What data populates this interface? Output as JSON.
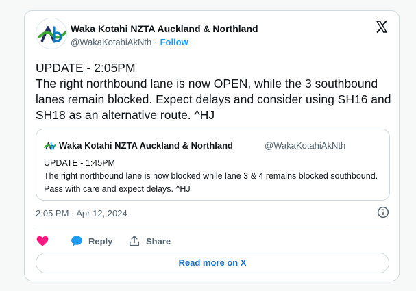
{
  "tweet": {
    "author_name": "Waka Kotahi NZTA Auckland & Northland",
    "author_handle": "@WakaKotahiAkNth",
    "separator": "·",
    "follow_label": "Follow",
    "text_line1": "UPDATE - 2:05PM",
    "text_line2": "The right northbound lane is now OPEN, while the 3 southbound lanes remain blocked. Expect delays and consider using SH16 and SH18 as an alternative route. ^HJ",
    "timestamp": "2:05 PM · Apr 12, 2024"
  },
  "quoted_tweet": {
    "author_name": "Waka Kotahi NZTA Auckland & Northland",
    "author_handle": "@WakaKotahiAkNth",
    "text_line1": "UPDATE - 1:45PM",
    "text_line2": "The right northbound lane is now blocked while lane 3 & 4 remains blocked southbound. Pass with care and expect delays. ^HJ"
  },
  "actions": {
    "like_icon": "heart-icon",
    "reply_label": "Reply",
    "reply_icon": "speech-bubble-icon",
    "share_label": "Share",
    "share_icon": "share-icon"
  },
  "read_more_label": "Read more on X",
  "colors": {
    "accent_blue": "#1d9bf0",
    "like_pink": "#f91880",
    "logo_green": "#3fa535",
    "logo_blue": "#0b7bc1",
    "text_secondary": "#536471"
  }
}
